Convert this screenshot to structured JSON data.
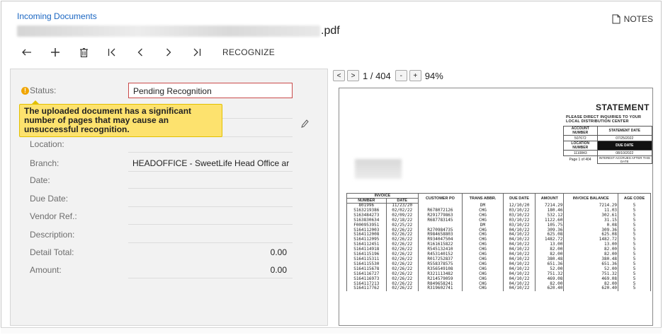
{
  "header": {
    "breadcrumb": "Incoming Documents",
    "file_extension": ".pdf",
    "notes_label": "NOTES"
  },
  "toolbar": {
    "back_icon": "←",
    "add_icon": "+",
    "delete_icon": "🗑",
    "first_icon": "I<",
    "prev_icon": "<",
    "next_icon": ">",
    "last_icon": ">I",
    "recognize_label": "RECOGNIZE"
  },
  "form": {
    "status_label": "Status:",
    "status_value": "Pending Recognition",
    "tooltip": "The uploaded document has a significant number of pages that may cause an unsuccessful recognition.",
    "location_label": "Location:",
    "branch_label": "Branch:",
    "branch_value": "HEADOFFICE - SweetLife Head Office ar",
    "date_label": "Date:",
    "due_date_label": "Due Date:",
    "vendor_ref_label": "Vendor Ref.:",
    "description_label": "Description:",
    "detail_total_label": "Detail Total:",
    "detail_total_value": "0.00",
    "amount_label": "Amount:",
    "amount_value": "0.00"
  },
  "viewer": {
    "prev": "<",
    "next": ">",
    "page_info": "1 / 404",
    "zoom_out": "-",
    "zoom_in": "+",
    "zoom": "94%"
  },
  "statement": {
    "title": "STATEMENT",
    "subtitle_line1": "PLEASE DIRECT INQUIRIES TO YOUR",
    "subtitle_line2": "LOCAL DISTRIBUTION CENTER",
    "account_number_label": "ACCOUNT NUMBER",
    "statement_date_label": "STATEMENT DATE",
    "account_number": "507672",
    "statement_date": "07/25/2022",
    "location_number_label": "LOCATION NUMBER",
    "due_date_label": "DUE DATE",
    "location_number": "1110843",
    "due_date": "08/10/2022",
    "page_of": "Page 1 of 404",
    "interest_note": "INTEREST ACCRUES AFTER THIS DATE",
    "col_invoice": "INVOICE",
    "col_number": "NUMBER",
    "col_date": "DATE",
    "col_customer_po": "CUSTOMER PO",
    "col_trans_abbr": "TRANS ABBR.",
    "col_due_date": "DUE DATE",
    "col_amount": "AMOUNT",
    "col_invoice_balance": "INVOICE BALANCE",
    "col_age_code": "AGE CODE",
    "rows": [
      [
        "801996",
        "11/23/20",
        "",
        "DM",
        "12/10/20",
        "7214.29",
        "7214.29",
        "5"
      ],
      [
        "S163219386",
        "02/02/22",
        "R678072126",
        "CHG",
        "03/10/22",
        "180.46",
        "11.03",
        "5"
      ],
      [
        "S163484273",
        "02/09/22",
        "R291779863",
        "CHG",
        "03/10/22",
        "532.12",
        "302.61",
        "5"
      ],
      [
        "S163830634",
        "02/18/22",
        "R687783145",
        "CHG",
        "03/10/22",
        "1122.60",
        "31.15",
        "5"
      ],
      [
        "F000953951",
        "02/25/22",
        "",
        "DM",
        "03/10/22",
        "105.75",
        "0.08",
        "5"
      ],
      [
        "S164112003",
        "02/26/22",
        "R270984735",
        "CHG",
        "04/10/22",
        "309.36",
        "309.36",
        "5"
      ],
      [
        "S164112008",
        "02/26/22",
        "R984658803",
        "CHG",
        "04/10/22",
        "625.08",
        "625.08",
        "5"
      ],
      [
        "S164112095",
        "02/26/22",
        "R934047504",
        "CHG",
        "04/10/22",
        "1482.72",
        "1482.72",
        "5"
      ],
      [
        "S164112451",
        "02/26/22",
        "R161615822",
        "CHG",
        "04/10/22",
        "13.00",
        "13.00",
        "5"
      ],
      [
        "S164114918",
        "02/26/22",
        "R545132410",
        "CHG",
        "04/10/22",
        "82.00",
        "82.00",
        "5"
      ],
      [
        "S164115196",
        "02/26/22",
        "R453140152",
        "CHG",
        "04/10/22",
        "82.00",
        "82.00",
        "5"
      ],
      [
        "S164115311",
        "02/26/22",
        "R017252837",
        "CHG",
        "04/10/22",
        "380.48",
        "380.48",
        "5"
      ],
      [
        "S164115530",
        "02/26/22",
        "R558378575",
        "CHG",
        "04/10/22",
        "651.36",
        "651.36",
        "5"
      ],
      [
        "S164115678",
        "02/26/22",
        "R356549108",
        "CHG",
        "04/10/22",
        "52.00",
        "52.00",
        "5"
      ],
      [
        "S164116727",
        "02/26/22",
        "R321113482",
        "CHG",
        "04/10/22",
        "751.32",
        "751.32",
        "5"
      ],
      [
        "S164116973",
        "02/26/22",
        "R214579059",
        "CHG",
        "04/10/22",
        "469.08",
        "469.08",
        "5"
      ],
      [
        "S164117213",
        "02/26/22",
        "R849658241",
        "CHG",
        "04/10/22",
        "82.00",
        "82.00",
        "5"
      ],
      [
        "S164117762",
        "02/26/22",
        "R319602741",
        "CHG",
        "04/10/22",
        "620.40",
        "620.40",
        "5"
      ]
    ]
  },
  "colors": {
    "link": "#1a66c2",
    "tooltip_bg": "#fde26e",
    "warning": "#f0a500",
    "status_border": "#c94a4a"
  }
}
